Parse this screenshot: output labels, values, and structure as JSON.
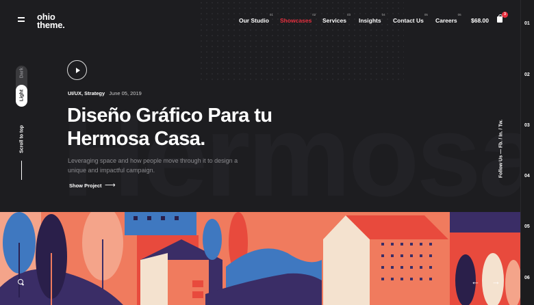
{
  "brand": {
    "line1": "ohio",
    "line2": "theme."
  },
  "nav": [
    {
      "label": "Our Studio",
      "num": "01",
      "active": false
    },
    {
      "label": "Showcases",
      "num": "02",
      "active": true
    },
    {
      "label": "Services",
      "num": "03",
      "active": false
    },
    {
      "label": "Insights",
      "num": "04",
      "active": false
    },
    {
      "label": "Contact Us",
      "num": "05",
      "active": false
    },
    {
      "label": "Careers",
      "num": "06",
      "active": false
    }
  ],
  "cart": {
    "price": "$68.00",
    "count": "3"
  },
  "theme_toggle": {
    "dark": "Dark",
    "light": "Light"
  },
  "scroll_to_top": "Scroll to top",
  "hero": {
    "meta_category": "UI/UX, Strategy",
    "meta_date": "June 05, 2019",
    "title": "Diseño Gráfico Para tu Hermosa Casa.",
    "description": "Leveraging space and how people move through it to design a unique and impactful campaign.",
    "cta": "Show Project",
    "bg_word": "HermosaGrafic"
  },
  "follow": {
    "label": "Follow Us",
    "links": "Fb. / In. / Tw."
  },
  "slides": [
    "01",
    "02",
    "03",
    "04",
    "05",
    "06"
  ],
  "colors": {
    "accent": "#e8303f",
    "coral": "#f07b5e",
    "navy": "#3a2d66",
    "blue": "#3f78c0",
    "cream": "#f4e2cf",
    "red": "#e84a3d"
  }
}
